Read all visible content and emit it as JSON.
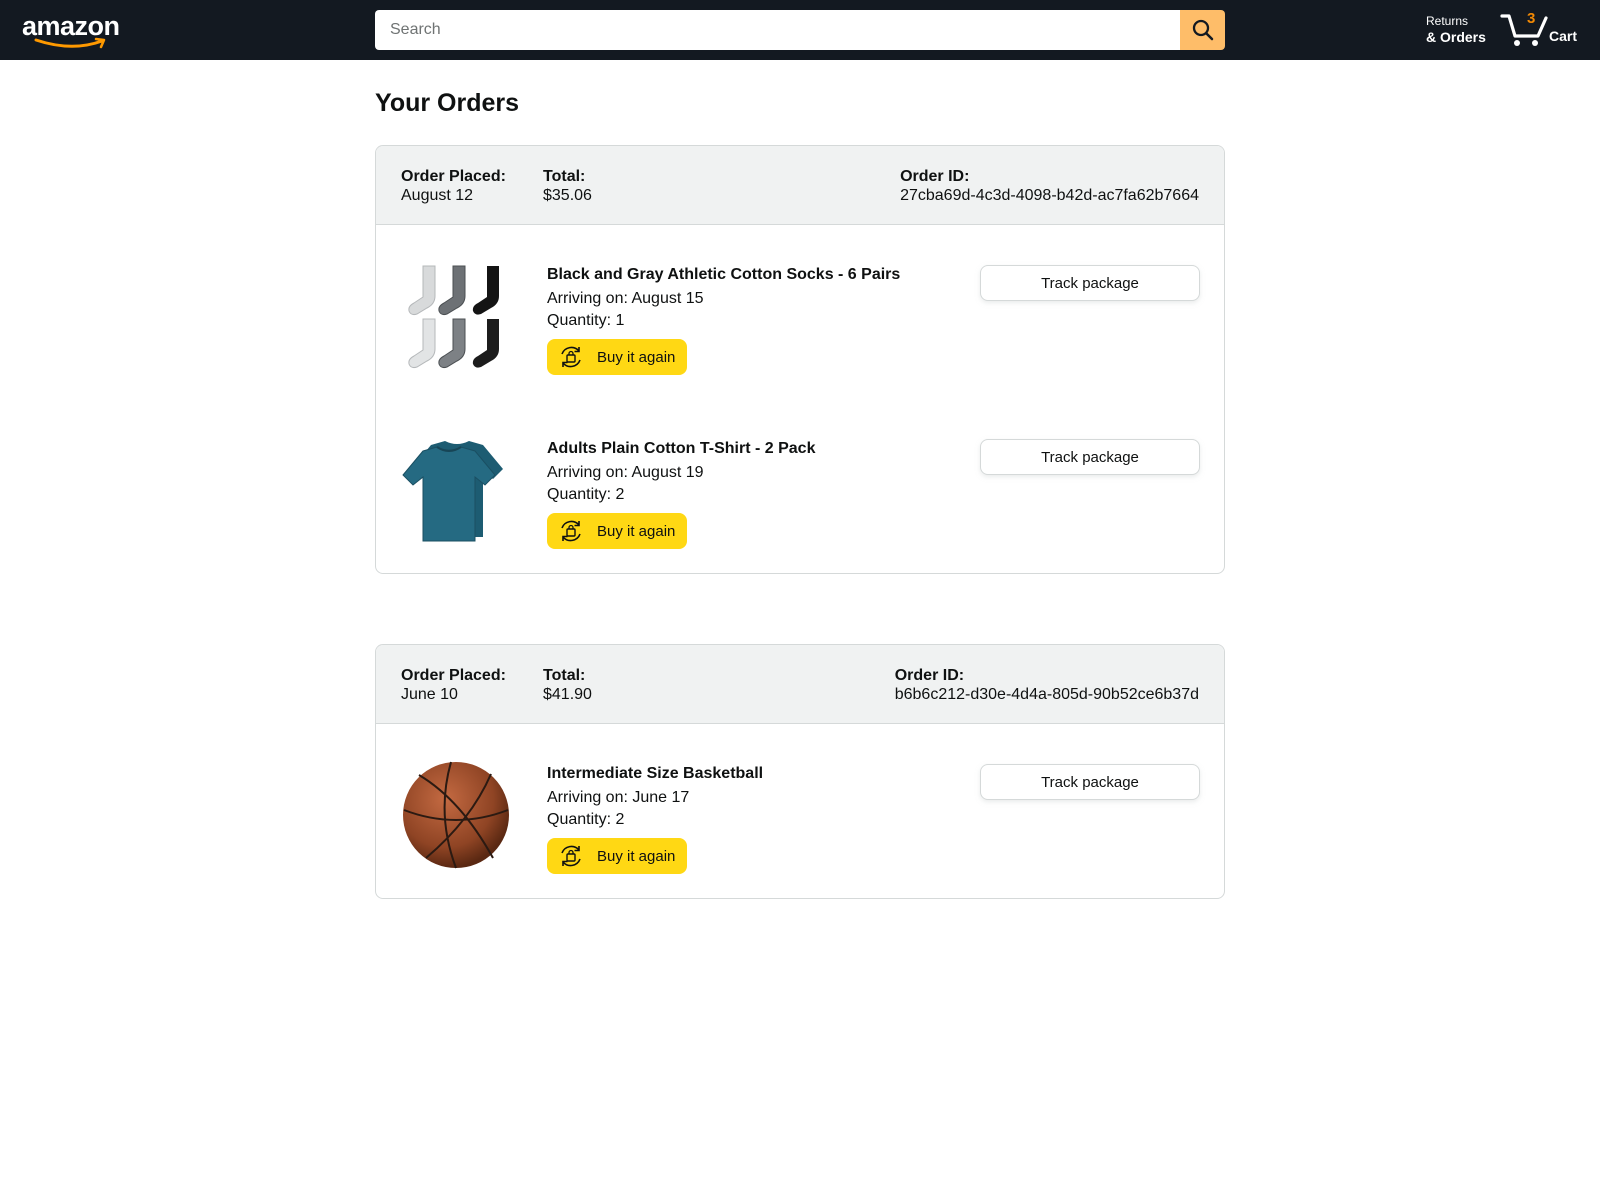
{
  "header": {
    "logo_text": "amazon",
    "search_placeholder": "Search",
    "search_icon": "search-icon",
    "returns_top": "Returns",
    "returns_bottom": "& Orders",
    "cart_count": "3",
    "cart_label": "Cart"
  },
  "page_title": "Your Orders",
  "colors": {
    "header_bg": "#131921",
    "search_button": "#febd69",
    "buy_again": "#ffd814",
    "cart_count": "#f08804",
    "order_header_bg": "#f0f2f2"
  },
  "orders": [
    {
      "placed_label": "Order Placed:",
      "placed_value": "August 12",
      "total_label": "Total:",
      "total_value": "$35.06",
      "id_label": "Order ID:",
      "id_value": "27cba69d-4c3d-4098-b42d-ac7fa62b7664",
      "items": [
        {
          "name": "Black and Gray Athletic Cotton Socks - 6 Pairs",
          "arriving": "Arriving on: August 15",
          "quantity": "Quantity: 1",
          "image": "socks-image",
          "buy_again": "Buy it again",
          "track": "Track package"
        },
        {
          "name": "Adults Plain Cotton T-Shirt - 2 Pack",
          "arriving": "Arriving on: August 19",
          "quantity": "Quantity: 2",
          "image": "tshirt-image",
          "buy_again": "Buy it again",
          "track": "Track package"
        }
      ]
    },
    {
      "placed_label": "Order Placed:",
      "placed_value": "June 10",
      "total_label": "Total:",
      "total_value": "$41.90",
      "id_label": "Order ID:",
      "id_value": "b6b6c212-d30e-4d4a-805d-90b52ce6b37d",
      "items": [
        {
          "name": "Intermediate Size Basketball",
          "arriving": "Arriving on: June 17",
          "quantity": "Quantity: 2",
          "image": "basketball-image",
          "buy_again": "Buy it again",
          "track": "Track package"
        }
      ]
    }
  ]
}
